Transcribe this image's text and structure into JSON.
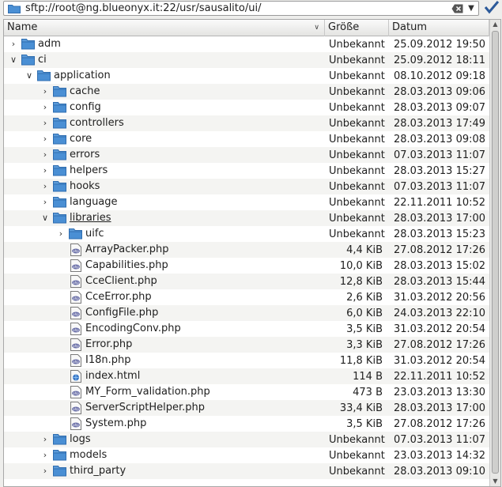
{
  "location": {
    "url": "sftp://root@ng.blueonyx.it:22/usr/sausalito/ui/"
  },
  "header": {
    "name": "Name",
    "size": "Größe",
    "date": "Datum"
  },
  "rows": [
    {
      "name": "adm",
      "size": "Unbekannt",
      "date": "25.09.2012 19:50",
      "type": "folder",
      "depth": 0,
      "expanded": false
    },
    {
      "name": "ci",
      "size": "Unbekannt",
      "date": "25.09.2012 18:11",
      "type": "folder",
      "depth": 0,
      "expanded": true
    },
    {
      "name": "application",
      "size": "Unbekannt",
      "date": "08.10.2012 09:18",
      "type": "folder",
      "depth": 1,
      "expanded": true
    },
    {
      "name": "cache",
      "size": "Unbekannt",
      "date": "28.03.2013 09:06",
      "type": "folder",
      "depth": 2,
      "expanded": false
    },
    {
      "name": "config",
      "size": "Unbekannt",
      "date": "28.03.2013 09:07",
      "type": "folder",
      "depth": 2,
      "expanded": false
    },
    {
      "name": "controllers",
      "size": "Unbekannt",
      "date": "28.03.2013 17:49",
      "type": "folder",
      "depth": 2,
      "expanded": false
    },
    {
      "name": "core",
      "size": "Unbekannt",
      "date": "28.03.2013 09:08",
      "type": "folder",
      "depth": 2,
      "expanded": false
    },
    {
      "name": "errors",
      "size": "Unbekannt",
      "date": "07.03.2013 11:07",
      "type": "folder",
      "depth": 2,
      "expanded": false
    },
    {
      "name": "helpers",
      "size": "Unbekannt",
      "date": "28.03.2013 15:27",
      "type": "folder",
      "depth": 2,
      "expanded": false
    },
    {
      "name": "hooks",
      "size": "Unbekannt",
      "date": "07.03.2013 11:07",
      "type": "folder",
      "depth": 2,
      "expanded": false
    },
    {
      "name": "language",
      "size": "Unbekannt",
      "date": "22.11.2011 10:52",
      "type": "folder",
      "depth": 2,
      "expanded": false
    },
    {
      "name": "libraries",
      "size": "Unbekannt",
      "date": "28.03.2013 17:00",
      "type": "folder",
      "depth": 2,
      "expanded": true,
      "underline": true
    },
    {
      "name": "uifc",
      "size": "Unbekannt",
      "date": "28.03.2013 15:23",
      "type": "folder",
      "depth": 3,
      "expanded": false
    },
    {
      "name": "ArrayPacker.php",
      "size": "4,4 KiB",
      "date": "27.08.2012 17:26",
      "type": "php",
      "depth": 3
    },
    {
      "name": "Capabilities.php",
      "size": "10,0 KiB",
      "date": "28.03.2013 15:02",
      "type": "php",
      "depth": 3
    },
    {
      "name": "CceClient.php",
      "size": "12,8 KiB",
      "date": "28.03.2013 15:44",
      "type": "php",
      "depth": 3
    },
    {
      "name": "CceError.php",
      "size": "2,6 KiB",
      "date": "31.03.2012 20:56",
      "type": "php",
      "depth": 3
    },
    {
      "name": "ConfigFile.php",
      "size": "6,0 KiB",
      "date": "24.03.2013 22:10",
      "type": "php",
      "depth": 3
    },
    {
      "name": "EncodingConv.php",
      "size": "3,5 KiB",
      "date": "31.03.2012 20:54",
      "type": "php",
      "depth": 3
    },
    {
      "name": "Error.php",
      "size": "3,3 KiB",
      "date": "27.08.2012 17:26",
      "type": "php",
      "depth": 3
    },
    {
      "name": "I18n.php",
      "size": "11,8 KiB",
      "date": "31.03.2012 20:54",
      "type": "php",
      "depth": 3
    },
    {
      "name": "index.html",
      "size": "114 B",
      "date": "22.11.2011 10:52",
      "type": "html",
      "depth": 3
    },
    {
      "name": "MY_Form_validation.php",
      "size": "473 B",
      "date": "23.03.2013 13:30",
      "type": "php",
      "depth": 3
    },
    {
      "name": "ServerScriptHelper.php",
      "size": "33,4 KiB",
      "date": "28.03.2013 17:00",
      "type": "php",
      "depth": 3
    },
    {
      "name": "System.php",
      "size": "3,5 KiB",
      "date": "27.08.2012 17:26",
      "type": "php",
      "depth": 3
    },
    {
      "name": "logs",
      "size": "Unbekannt",
      "date": "07.03.2013 11:07",
      "type": "folder",
      "depth": 2,
      "expanded": false
    },
    {
      "name": "models",
      "size": "Unbekannt",
      "date": "23.03.2013 14:32",
      "type": "folder",
      "depth": 2,
      "expanded": false
    },
    {
      "name": "third_party",
      "size": "Unbekannt",
      "date": "28.03.2013 09:10",
      "type": "folder",
      "depth": 2,
      "expanded": false
    }
  ],
  "colors": {
    "folder": "#4a8fd4",
    "folder_dark": "#2f6db0",
    "php": "#6a6fa8"
  }
}
